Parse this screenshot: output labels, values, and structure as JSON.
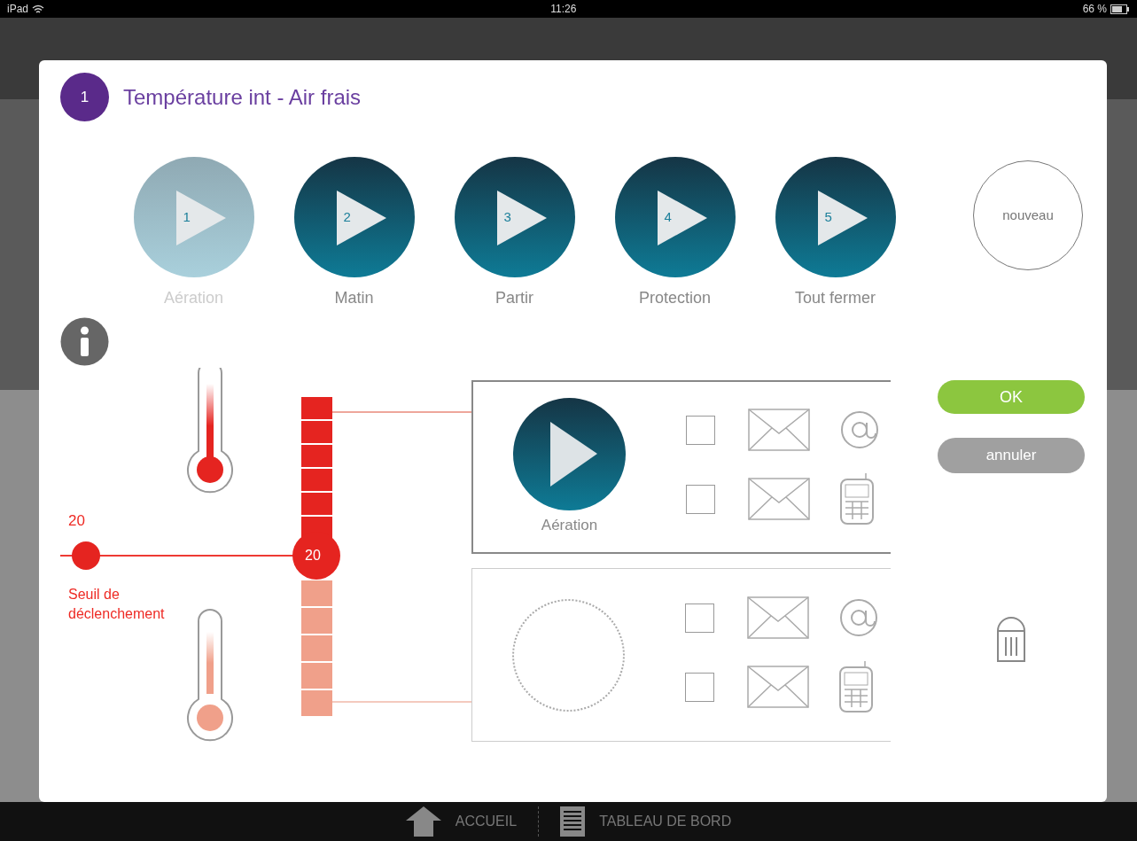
{
  "status_bar": {
    "carrier": "iPad",
    "time": "11:26",
    "battery": "66 %"
  },
  "dialog": {
    "number": "1",
    "title": "Température int - Air frais",
    "scenes": [
      {
        "number": "1",
        "label": "Aération",
        "disabled": true
      },
      {
        "number": "2",
        "label": "Matin",
        "disabled": false
      },
      {
        "number": "3",
        "label": "Partir",
        "disabled": false
      },
      {
        "number": "4",
        "label": "Protection",
        "disabled": false
      },
      {
        "number": "5",
        "label": "Tout fermer",
        "disabled": false
      }
    ],
    "new_button": "nouveau",
    "threshold": {
      "value": "20",
      "marker": "20",
      "label": "Seuil de déclenchement"
    },
    "actions": [
      {
        "scene": "Aération",
        "notifications": [
          {
            "kind": "email",
            "checked": false
          },
          {
            "kind": "sms",
            "checked": false
          }
        ]
      },
      {
        "notifications": [
          {
            "kind": "email",
            "checked": false
          },
          {
            "kind": "sms",
            "checked": false
          }
        ]
      }
    ],
    "buttons": {
      "ok": "OK",
      "cancel": "annuler"
    }
  },
  "bottom_nav": [
    {
      "label": "ACCUEIL",
      "kind": "home"
    },
    {
      "label": "TABLEAU DE BORD",
      "kind": "dashboard"
    }
  ]
}
